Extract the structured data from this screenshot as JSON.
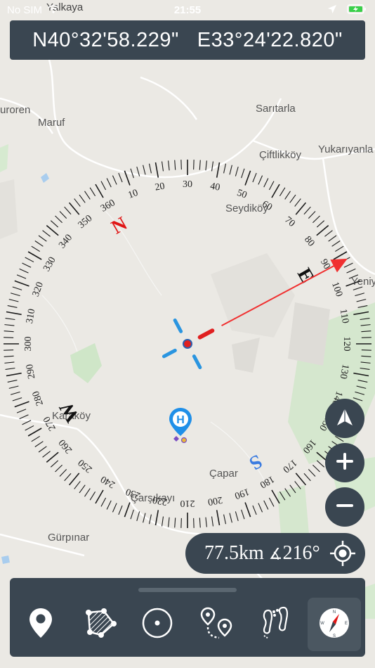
{
  "status": {
    "carrier": "No SIM",
    "time": "21:55"
  },
  "coordinates": {
    "lat": "N40°32'58.229\"",
    "lon": "E33°24'22.820\""
  },
  "places": [
    {
      "label": "Yalkaya",
      "key": "yalkaya"
    },
    {
      "label": "uroren",
      "key": "uroren"
    },
    {
      "label": "Maruf",
      "key": "maruf"
    },
    {
      "label": "Sarıtarla",
      "key": "saritarla"
    },
    {
      "label": "Çiftlikköy",
      "key": "ciftlikkoy"
    },
    {
      "label": "Yukarıyanla",
      "key": "yukariyanla"
    },
    {
      "label": "Seydiköy",
      "key": "seydikoy"
    },
    {
      "label": "Karaköy",
      "key": "karakoy"
    },
    {
      "label": "Çapar",
      "key": "capar"
    },
    {
      "label": "Çarşıkayı",
      "key": "carsikayi"
    },
    {
      "label": "Gürpınar",
      "key": "gurpinar"
    },
    {
      "label": "Yeniyurt",
      "key": "yeniyurt"
    }
  ],
  "compass": {
    "cardinals": {
      "n": "N",
      "e": "E",
      "s": "S",
      "w": "W"
    },
    "degree_labels": [
      "360",
      "10",
      "20",
      "30",
      "40",
      "50",
      "60",
      "70",
      "80",
      "90",
      "100",
      "110",
      "120",
      "130",
      "140",
      "150",
      "160",
      "170",
      "180",
      "190",
      "200",
      "210",
      "220",
      "230",
      "240",
      "250",
      "260",
      "270",
      "280",
      "290",
      "300",
      "310",
      "320",
      "330",
      "340",
      "350"
    ],
    "colors": {
      "north": "#e01515",
      "south": "#3a7be0",
      "needle": "#f03030"
    }
  },
  "marker": {
    "label": "H",
    "color": "#1f8fe8"
  },
  "info": {
    "distance": "77.5km",
    "bearing_symbol": "∡",
    "bearing": "216°"
  },
  "toolbar": {
    "items": [
      {
        "name": "location-pin-tool",
        "icon": "location-pin-icon"
      },
      {
        "name": "area-measure-tool",
        "icon": "polygon-area-icon"
      },
      {
        "name": "circle-tool",
        "icon": "circle-target-icon"
      },
      {
        "name": "route-tool",
        "icon": "route-pins-icon"
      },
      {
        "name": "track-tool",
        "icon": "footprints-icon"
      },
      {
        "name": "compass-tool",
        "icon": "compass-icon"
      }
    ]
  }
}
